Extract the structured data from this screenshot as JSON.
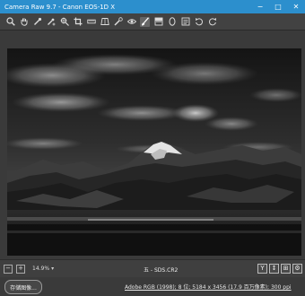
{
  "window": {
    "title": "Camera Raw 9.7  -  Canon EOS-1D X",
    "minimize": "−",
    "maximize": "□",
    "close": "✕"
  },
  "toolbar": {
    "tools": [
      {
        "name": "zoom-tool",
        "icon": "magnifier-icon"
      },
      {
        "name": "hand-tool",
        "icon": "hand-icon"
      },
      {
        "name": "white-balance-tool",
        "icon": "eyedropper-icon"
      },
      {
        "name": "color-sampler-tool",
        "icon": "eyedropper-plus-icon"
      },
      {
        "name": "targeted-adjustment-tool",
        "icon": "target-adjust-icon"
      },
      {
        "name": "crop-tool",
        "icon": "crop-icon"
      },
      {
        "name": "straighten-tool",
        "icon": "straighten-icon"
      },
      {
        "name": "transform-tool",
        "icon": "transform-icon"
      },
      {
        "name": "spot-removal-tool",
        "icon": "spot-heal-icon"
      },
      {
        "name": "red-eye-tool",
        "icon": "eye-icon"
      },
      {
        "name": "adjustment-brush-tool",
        "icon": "brush-icon"
      },
      {
        "name": "graduated-filter-tool",
        "icon": "gradient-icon"
      },
      {
        "name": "radial-filter-tool",
        "icon": "radial-icon"
      },
      {
        "name": "preferences",
        "icon": "list-icon"
      },
      {
        "name": "rotate-ccw",
        "icon": "rotate-left-icon"
      },
      {
        "name": "rotate-cw",
        "icon": "rotate-right-icon"
      }
    ]
  },
  "status": {
    "zoom": "14.9%",
    "zoom_caret": "▾",
    "filename": "五 - SDS.CR2",
    "minus": "−",
    "plus": "+",
    "right_buttons": [
      "Y",
      "↕",
      "⊞",
      "⚙"
    ]
  },
  "footer": {
    "save_button": "存储图像...",
    "workflow": "Adobe RGB (1998); 8 位; 5184 x 3456 (17.9 百万像素); 300 ppi"
  }
}
